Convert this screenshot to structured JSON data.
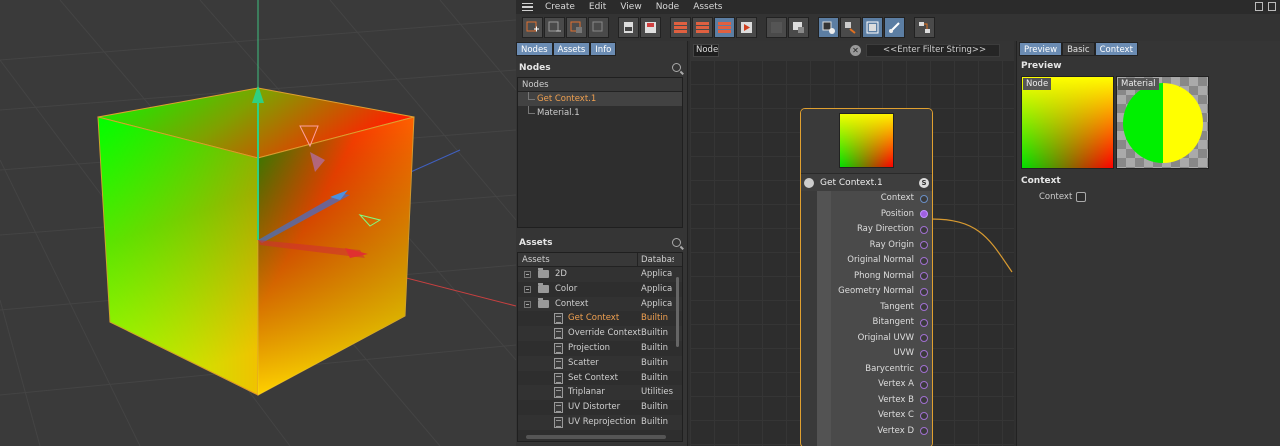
{
  "menubar": {
    "items": [
      "Create",
      "Edit",
      "View",
      "Node",
      "Assets"
    ]
  },
  "left_tabs": [
    "Nodes",
    "Assets",
    "Info"
  ],
  "nodes_panel": {
    "title": "Nodes",
    "column": "Nodes",
    "items": [
      {
        "label": "Get Context.1",
        "selected": true
      },
      {
        "label": "Material.1",
        "selected": false
      }
    ]
  },
  "assets_panel": {
    "title": "Assets",
    "columns": [
      "Assets",
      "Database"
    ],
    "rows": [
      {
        "name": "2D",
        "database": "Applica",
        "kind": "folder"
      },
      {
        "name": "Color",
        "database": "Applica",
        "kind": "folder"
      },
      {
        "name": "Context",
        "database": "Applica",
        "kind": "folder-open"
      },
      {
        "name": "Get Context",
        "database": "Builtin",
        "kind": "node",
        "selected": true
      },
      {
        "name": "Override Context",
        "database": "Builtin",
        "kind": "node"
      },
      {
        "name": "Projection",
        "database": "Builtin",
        "kind": "node"
      },
      {
        "name": "Scatter",
        "database": "Builtin",
        "kind": "node"
      },
      {
        "name": "Set Context",
        "database": "Builtin",
        "kind": "node"
      },
      {
        "name": "Triplanar",
        "database": "Utilities",
        "kind": "node"
      },
      {
        "name": "UV Distorter",
        "database": "Builtin",
        "kind": "node"
      },
      {
        "name": "UV Reprojection",
        "database": "Builtin",
        "kind": "node"
      }
    ]
  },
  "graph_header": {
    "node_field": "Node",
    "filter_placeholder": "<<Enter Filter String>>"
  },
  "node": {
    "title": "Get Context.1",
    "badge": "S",
    "ports": [
      {
        "label": "Context",
        "type": "blue"
      },
      {
        "label": "Position",
        "type": "filled"
      },
      {
        "label": "Ray Direction",
        "type": "normal"
      },
      {
        "label": "Ray Origin",
        "type": "normal"
      },
      {
        "label": "Original Normal",
        "type": "normal"
      },
      {
        "label": "Phong Normal",
        "type": "normal"
      },
      {
        "label": "Geometry Normal",
        "type": "normal"
      },
      {
        "label": "Tangent",
        "type": "normal"
      },
      {
        "label": "Bitangent",
        "type": "normal"
      },
      {
        "label": "Original UVW",
        "type": "normal"
      },
      {
        "label": "UVW",
        "type": "normal"
      },
      {
        "label": "Barycentric",
        "type": "normal"
      },
      {
        "label": "Vertex A",
        "type": "normal"
      },
      {
        "label": "Vertex B",
        "type": "normal"
      },
      {
        "label": "Vertex C",
        "type": "normal"
      },
      {
        "label": "Vertex D",
        "type": "normal"
      }
    ]
  },
  "attr_tabs": [
    "Preview",
    "Basic",
    "Context"
  ],
  "preview": {
    "heading": "Preview",
    "node_caption": "Node",
    "material_caption": "Material"
  },
  "context_section": {
    "heading": "Context",
    "label": "Context",
    "checked": false
  },
  "colors": {
    "selection": "#f0a050",
    "node_border": "#e0a030",
    "tab_active": "#6b8cb3"
  }
}
